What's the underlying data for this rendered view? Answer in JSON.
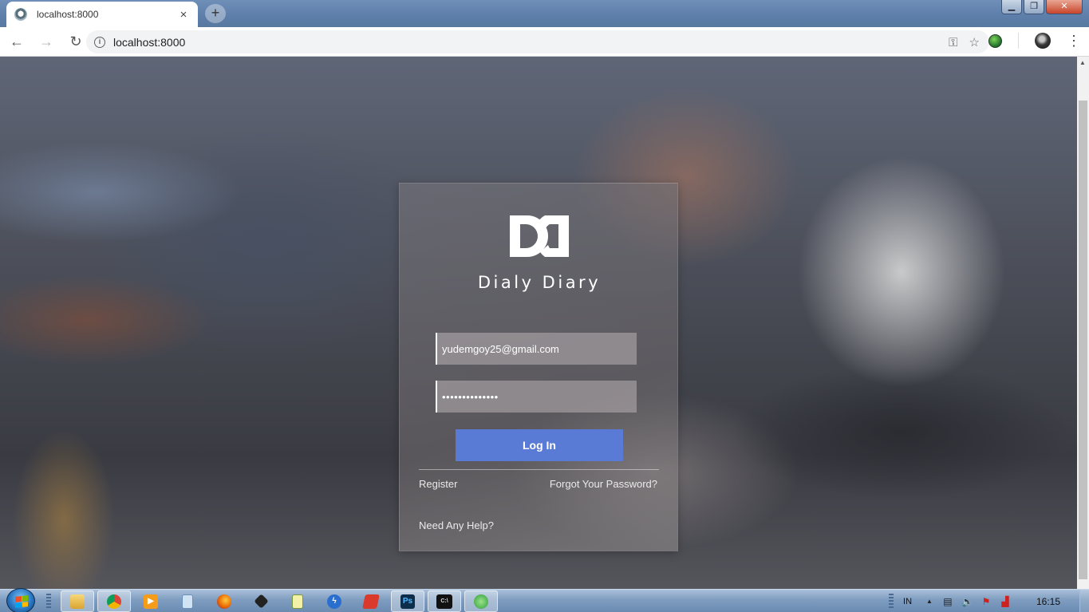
{
  "browser": {
    "tab": {
      "title": "localhost:8000",
      "close": "×"
    },
    "new_tab": "+",
    "window_controls": {
      "minimize": "▁",
      "maximize": "❐",
      "close": "✕"
    },
    "nav": {
      "back": "←",
      "forward": "→",
      "reload": "↻"
    },
    "address": {
      "info": "i",
      "url": "localhost:8000"
    },
    "omnibox_icons": {
      "key": "⚿",
      "star": "☆"
    },
    "menu": "⋮"
  },
  "page": {
    "brand": "Dialy Diary",
    "login": {
      "email_value": "yudemgoy25@gmail.com",
      "password_value": "••••••••••••••",
      "submit_label": "Log In"
    },
    "links": {
      "register": "Register",
      "forgot": "Forgot Your Password?",
      "help": "Need Any Help?"
    },
    "colors": {
      "button": "#5a7bd5"
    }
  },
  "taskbar": {
    "apps": [
      "file-explorer",
      "chrome",
      "media-player",
      "notepad",
      "firefox",
      "inkscape",
      "notes",
      "flash",
      "pdf-reader",
      "photoshop",
      "cmd",
      "spotify-like"
    ],
    "photoshop_label": "Ps",
    "cmd_label": "C:\\",
    "tray": {
      "lang": "IN",
      "clock": "16:15"
    }
  },
  "scrollbar": {
    "up": "▲"
  }
}
